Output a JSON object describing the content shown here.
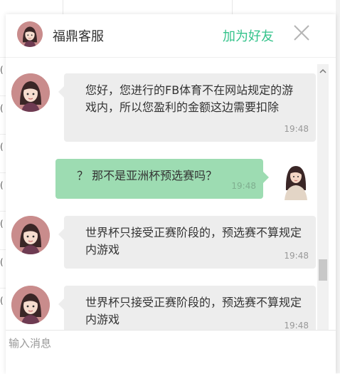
{
  "header": {
    "title": "福鼎客服",
    "add_friend_label": "加为好友"
  },
  "left_column": {
    "stubs": [
      "(",
      "(",
      "(",
      "(",
      "(",
      "(",
      "("
    ]
  },
  "messages": [
    {
      "from": "agent",
      "text": "您好，您进行的FB体育不在网站规定的游戏内，所以您盈利的金额这边需要扣除",
      "time": "19:48"
    },
    {
      "from": "me",
      "text": "？ 那不是亚洲杯预选赛吗？",
      "time": "19:48"
    },
    {
      "from": "agent",
      "text": "世界杯只接受正赛阶段的，预选赛不算规定内游戏",
      "time": "19:48"
    },
    {
      "from": "agent",
      "text": "世界杯只接受正赛阶段的，预选赛不算规定内游戏",
      "time": "19:48"
    }
  ],
  "composer": {
    "placeholder": "输入消息"
  },
  "colors": {
    "accent": "#34c38b",
    "my_bubble": "#9ddcb2",
    "agent_bubble": "#ededed"
  },
  "icons": {
    "close": "close-icon",
    "scroll_up": "chevron-up-icon"
  }
}
